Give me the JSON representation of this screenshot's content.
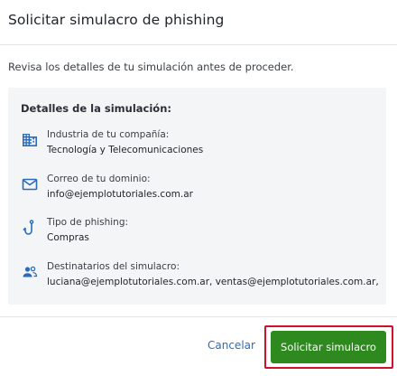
{
  "dialog": {
    "title": "Solicitar simulacro de phishing",
    "intro": "Revisa los detalles de tu simulación antes de proceder."
  },
  "details": {
    "heading": "Detalles de la simulación:",
    "items": [
      {
        "icon": "building-icon",
        "label": "Industria de tu compañía:",
        "value": "Tecnología y Telecomunicaciones"
      },
      {
        "icon": "mail-icon",
        "label": "Correo de tu dominio:",
        "value": "info@ejemplotutoriales.com.ar"
      },
      {
        "icon": "fishing-hook-icon",
        "label": "Tipo de phishing:",
        "value": "Compras"
      },
      {
        "icon": "people-icon",
        "label": "Destinatarios del simulacro:",
        "value": "luciana@ejemplotutoriales.com.ar, ventas@ejemplotutoriales.com.ar, ..."
      }
    ]
  },
  "actions": {
    "cancel_label": "Cancelar",
    "submit_label": "Solicitar simulacro"
  },
  "colors": {
    "icon": "#2c6bb8",
    "primary": "#2e8a1e",
    "link": "#2c6bb8",
    "highlight": "#d0112b"
  }
}
